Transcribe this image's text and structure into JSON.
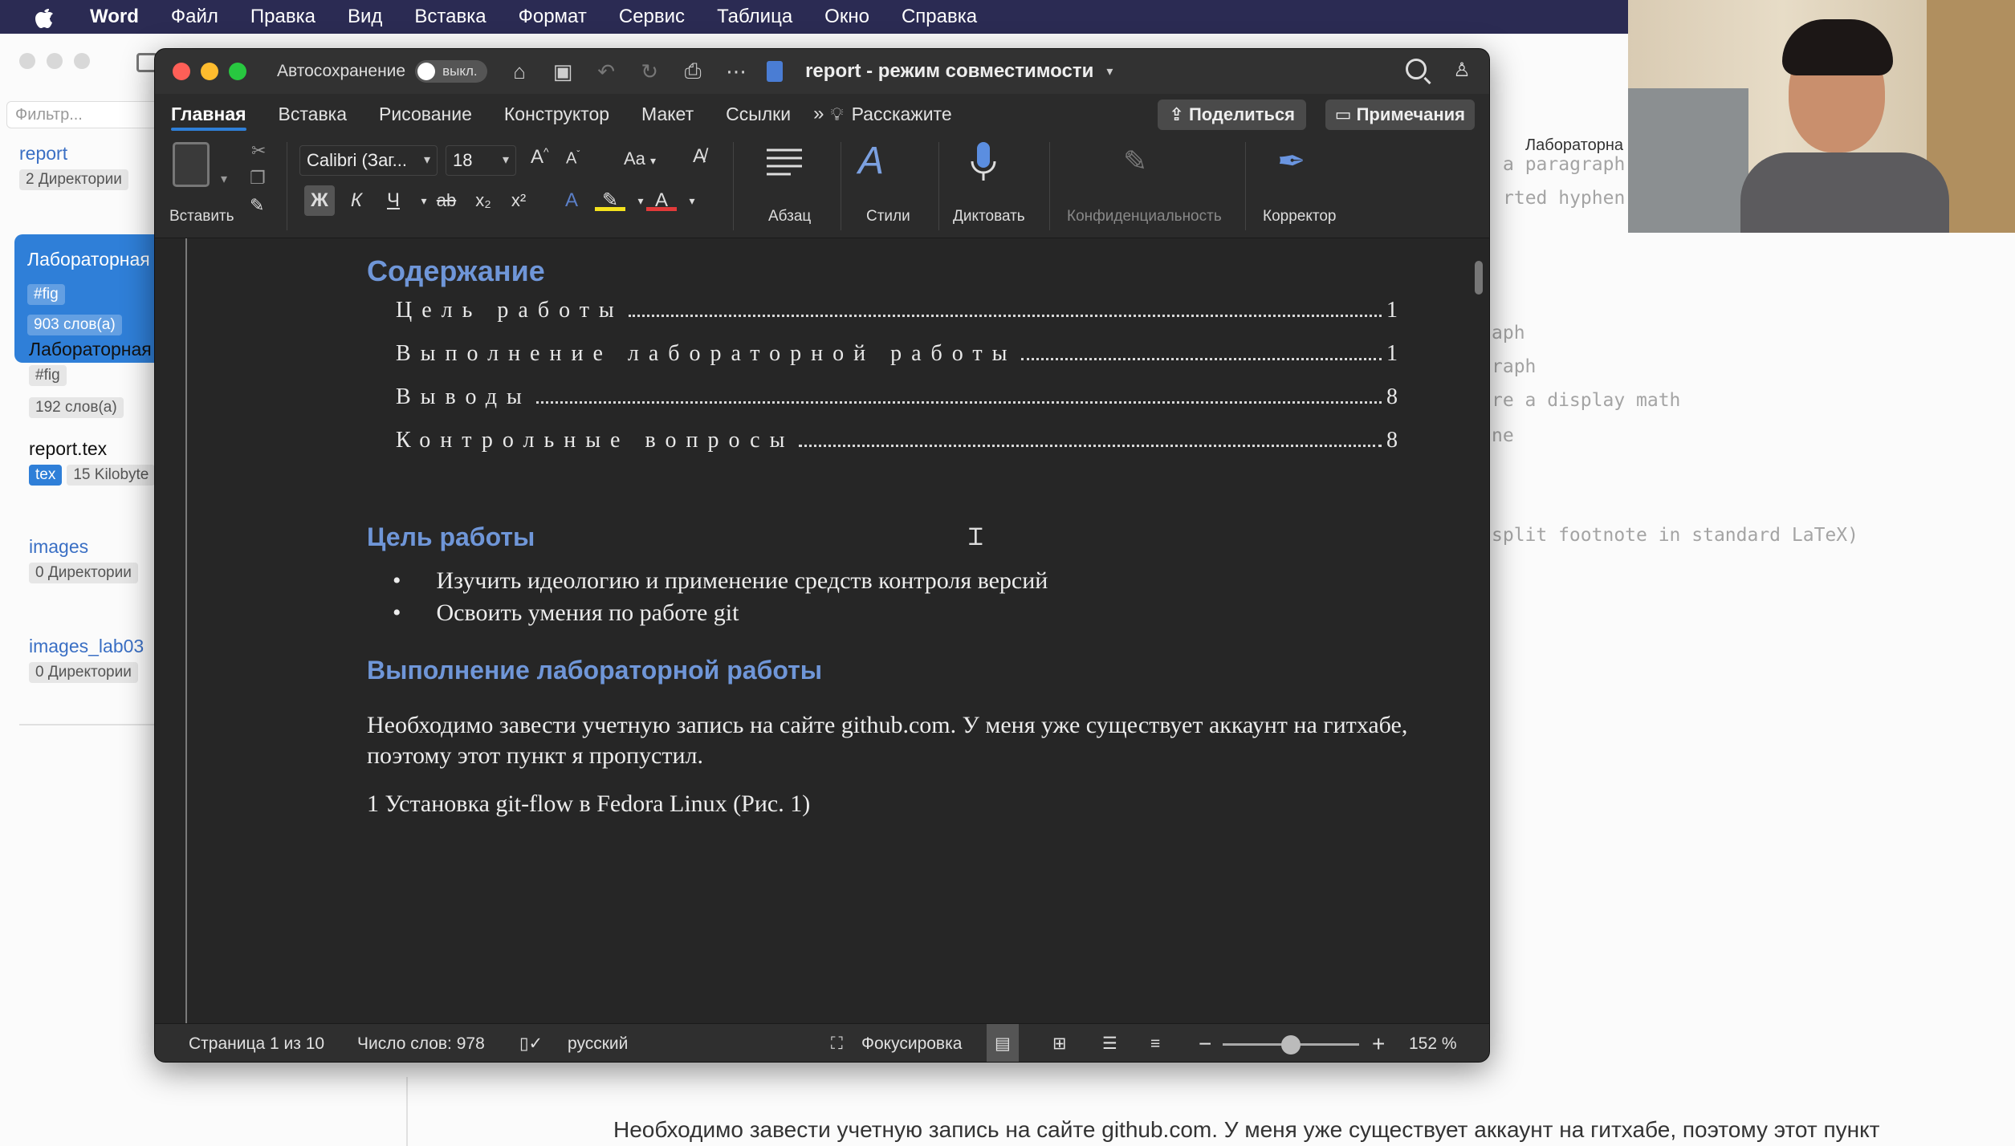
{
  "menubar": {
    "app": "Word",
    "items": [
      "Файл",
      "Правка",
      "Вид",
      "Вставка",
      "Формат",
      "Сервис",
      "Таблица",
      "Окно",
      "Справка"
    ],
    "status_a": "A"
  },
  "bg_app": {
    "filter_placeholder": "Фильтр...",
    "files": [
      {
        "name": "report",
        "meta": "2 Директории"
      },
      {
        "name": "Лабораторная",
        "tag": "#fig",
        "meta": "903 слов(а)"
      },
      {
        "name": "Лабораторная",
        "tag": "#fig",
        "meta": "192 слов(а)"
      },
      {
        "name": "report.tex",
        "tag": "tex",
        "meta": "15 Kilobyte"
      },
      {
        "name": "images",
        "meta": "0 Директории"
      },
      {
        "name": "images_lab03",
        "meta": "0 Директории"
      }
    ],
    "right_title": "Лабораторна",
    "code_lines": [
      "a paragraph",
      "rted hyphen",
      "aph",
      "raph",
      "re a display math",
      "ne",
      "split footnote in standard LaTeX)"
    ],
    "preview_text": "Необходимо завести учетную запись на сайте github.com. У меня уже существует аккаунт на гитхабе, поэтому этот пункт я пропустил."
  },
  "word": {
    "autosave_label": "Автосохранение",
    "autosave_state": "выкл.",
    "doc_title": "report  -  режим совместимости",
    "tabs": [
      "Главная",
      "Вставка",
      "Рисование",
      "Конструктор",
      "Макет",
      "Ссылки"
    ],
    "tell_me": "Расскажите",
    "share": "Поделиться",
    "comments": "Примечания",
    "ribbon": {
      "paste": "Вставить",
      "font": "Calibri (Заг...",
      "size": "18",
      "paragraph": "Абзац",
      "styles": "Стили",
      "dictate": "Диктовать",
      "sensitivity": "Конфиденциальность",
      "editor": "Корректор",
      "bold": "Ж",
      "italic": "К",
      "underline": "Ч",
      "strike": "ab",
      "sub": "x₂",
      "sup": "x²",
      "case": "Aa"
    },
    "document": {
      "toc_title": "Содержание",
      "toc": [
        {
          "label": "Цель работы",
          "page": "1"
        },
        {
          "label": "Выполнение лабораторной работы",
          "page": "1"
        },
        {
          "label": "Выводы",
          "page": "8"
        },
        {
          "label": "Контрольные вопросы",
          "page": "8"
        }
      ],
      "h_goal": "Цель работы",
      "bullets": [
        "Изучить идеологию и применение средств контроля версий",
        "Освоить умения по работе git"
      ],
      "h_exec": "Выполнение лабораторной работы",
      "para1": "Необходимо завести учетную запись на сайте github.com. У меня уже существует аккаунт на гитхабе, поэтому этот пункт я пропустил.",
      "para2": "1 Установка git-flow в Fedora Linux (Рис. 1)"
    },
    "statusbar": {
      "page": "Страница 1 из 10",
      "words": "Число слов: 978",
      "lang": "русский",
      "focus": "Фокусировка",
      "zoom": "152 %",
      "zoom_fraction": 0.5
    }
  },
  "colors": {
    "menubar": "#2b2b53",
    "heading_blue": "#6f96d8",
    "selection_blue": "#2f7fd8"
  }
}
